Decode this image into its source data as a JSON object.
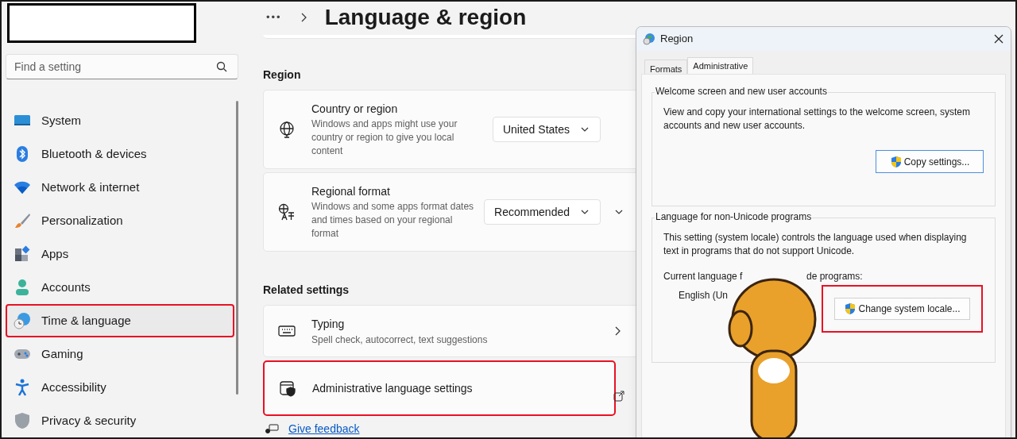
{
  "sidebar": {
    "search": {
      "placeholder": "Find a setting"
    },
    "items": [
      {
        "label": "System",
        "selected": false
      },
      {
        "label": "Bluetooth & devices",
        "selected": false
      },
      {
        "label": "Network & internet",
        "selected": false
      },
      {
        "label": "Personalization",
        "selected": false
      },
      {
        "label": "Apps",
        "selected": false
      },
      {
        "label": "Accounts",
        "selected": false
      },
      {
        "label": "Time & language",
        "selected": true
      },
      {
        "label": "Gaming",
        "selected": false
      },
      {
        "label": "Accessibility",
        "selected": false
      },
      {
        "label": "Privacy & security",
        "selected": false
      }
    ]
  },
  "header": {
    "more": "•••",
    "title": "Language & region"
  },
  "region": {
    "heading": "Region",
    "cards": [
      {
        "title": "Country or region",
        "description": "Windows and apps might use your country or region to give you local content",
        "dropdown": "United States",
        "expandable": false
      },
      {
        "title": "Regional format",
        "description": "Windows and some apps format dates and times based on your regional format",
        "dropdown": "Recommended",
        "expandable": true
      }
    ]
  },
  "related": {
    "heading": "Related settings",
    "items": [
      {
        "kind": "chevron",
        "title": "Typing",
        "description": "Spell check, autocorrect, text suggestions"
      },
      {
        "kind": "external",
        "title": "Administrative language settings"
      }
    ]
  },
  "feedback": "Give feedback",
  "dialog": {
    "title": "Region",
    "tabs": [
      {
        "label": "Formats",
        "selected": false
      },
      {
        "label": "Administrative",
        "selected": true
      }
    ],
    "welcome": {
      "title": "Welcome screen and new user accounts",
      "description": "View and copy your international settings to the welcome screen, system accounts and new user accounts.",
      "button": "Copy settings..."
    },
    "non_unicode": {
      "title": "Language for non-Unicode programs",
      "description": "This setting (system locale) controls the language used when displaying text in programs that do not support Unicode.",
      "current_label_start": "Current language f",
      "current_label_end": "de programs:",
      "current_value": "English (Un",
      "button": "Change system locale..."
    }
  }
}
